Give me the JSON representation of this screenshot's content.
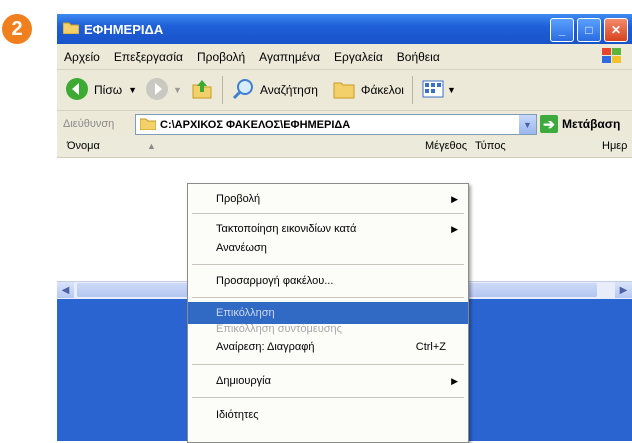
{
  "step_badge": "2",
  "window": {
    "title": "ΕΦΗΜΕΡΙΔΑ",
    "controls": {
      "minimize": "_",
      "maximize": "□",
      "close": "✕"
    }
  },
  "menubar": [
    "Αρχείο",
    "Επεξεργασία",
    "Προβολή",
    "Αγαπημένα",
    "Εργαλεία",
    "Βοήθεια"
  ],
  "toolbar": {
    "back": "Πίσω",
    "search": "Αναζήτηση",
    "folders": "Φάκελοι"
  },
  "address": {
    "label": "Διεύθυνση",
    "path": "C:\\ΑΡΧΙΚΟΣ ΦΑΚΕΛΟΣ\\ΕΦΗΜΕΡΙΔΑ",
    "go": "Μετάβαση"
  },
  "columns": [
    "Όνομα",
    "Μέγεθος",
    "Τύπος",
    "Ημερ"
  ],
  "context_menu": [
    {
      "label": "Προβολή",
      "submenu": true
    },
    {
      "label": "Τακτοποίηση εικονιδίων κατά",
      "submenu": true
    },
    {
      "label": "Ανανέωση"
    },
    {
      "label": "Προσαρμογή φακέλου..."
    },
    {
      "label": "Επικόλληση",
      "state": "highlighted-disabled"
    },
    {
      "label": "Επικόλληση συντόμευσης",
      "state": "disabled"
    },
    {
      "label": "Αναίρεση: Διαγραφή",
      "shortcut": "Ctrl+Z"
    },
    {
      "label": "Δημιουργία",
      "submenu": true
    },
    {
      "label": "Ιδιότητες"
    }
  ],
  "colors": {
    "accent": "#316ac5",
    "titlebar": "#1f5fd8",
    "badge": "#f07f1e"
  }
}
